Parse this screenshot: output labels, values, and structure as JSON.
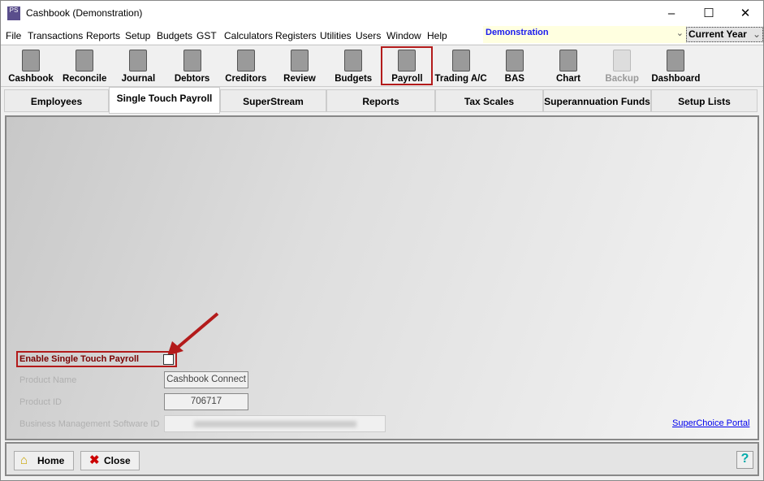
{
  "window": {
    "title": "Cashbook (Demonstration)",
    "app_icon": "PS"
  },
  "menu": [
    "File",
    "Transactions",
    "Reports",
    "Setup",
    "Budgets",
    "GST",
    "Calculators",
    "Registers",
    "Utilities",
    "Users",
    "Window",
    "Help"
  ],
  "company_select": {
    "value": "Demonstration"
  },
  "year_select": {
    "value": "Current Year"
  },
  "toolbar": [
    {
      "label": "Cashbook",
      "icon": "cashbook-icon"
    },
    {
      "label": "Reconcile",
      "icon": "reconcile-icon"
    },
    {
      "label": "Journal",
      "icon": "journal-icon"
    },
    {
      "label": "Debtors",
      "icon": "debtors-icon"
    },
    {
      "label": "Creditors",
      "icon": "creditors-icon"
    },
    {
      "label": "Review",
      "icon": "review-icon"
    },
    {
      "label": "Budgets",
      "icon": "budgets-icon"
    },
    {
      "label": "Payroll",
      "icon": "payroll-icon"
    },
    {
      "label": "Trading A/C",
      "icon": "trading-icon"
    },
    {
      "label": "BAS",
      "icon": "bas-icon"
    },
    {
      "label": "Chart",
      "icon": "chart-icon"
    },
    {
      "label": "Backup",
      "icon": "backup-icon"
    },
    {
      "label": "Dashboard",
      "icon": "dashboard-icon"
    }
  ],
  "tabs": [
    "Employees",
    "Single Touch Payroll",
    "SuperStream",
    "Reports",
    "Tax Scales",
    "Superannuation Funds",
    "Setup Lists"
  ],
  "stp": {
    "enable_label": "Enable Single Touch Payroll",
    "enabled": false,
    "product_name_label": "Product Name",
    "product_name": "Cashbook Connect",
    "product_id_label": "Product ID",
    "product_id": "706717",
    "bms_id_label": "Business Management Software ID",
    "portal_link": "SuperChoice Portal"
  },
  "footer": {
    "home": "Home",
    "close": "Close",
    "help": "?"
  },
  "colors": {
    "highlight": "#b31b1b",
    "link": "#0000ee",
    "company": "#1a1aee"
  }
}
